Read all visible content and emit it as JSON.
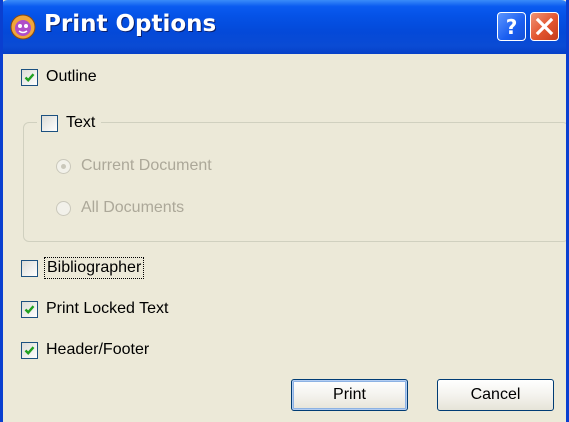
{
  "window": {
    "title": "Print Options",
    "title_icon": "app-icon",
    "help_icon": "help-icon",
    "close_icon": "close-icon"
  },
  "options": {
    "outline": {
      "label": "Outline",
      "checked": true
    },
    "text": {
      "label": "Text",
      "checked": false
    },
    "current_document": {
      "label": "Current Document",
      "selected": true,
      "enabled": false
    },
    "all_documents": {
      "label": "All Documents",
      "selected": false,
      "enabled": false
    },
    "bibliographer": {
      "label": "Bibliographer",
      "checked": false
    },
    "print_locked_text": {
      "label": "Print Locked Text",
      "checked": true
    },
    "header_footer": {
      "label": "Header/Footer",
      "checked": true
    }
  },
  "buttons": {
    "print": "Print",
    "cancel": "Cancel"
  },
  "colors": {
    "titlebar": "#0552e6",
    "dialog_bg": "#ece9d8",
    "check_mark": "#21a121",
    "disabled_text": "#aca899"
  }
}
